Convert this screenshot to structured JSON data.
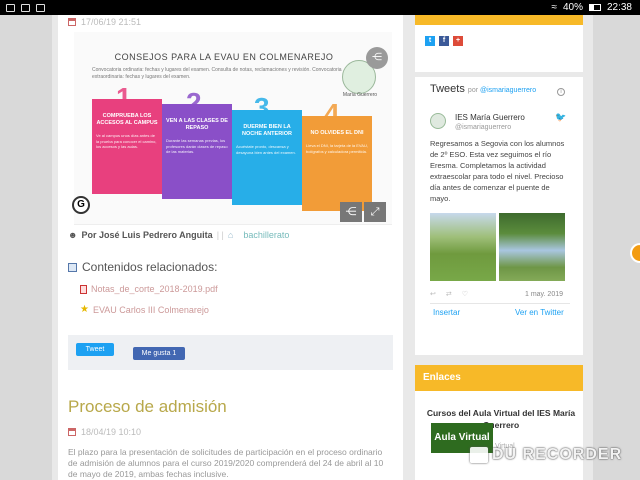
{
  "status_bar": {
    "time": "22:38",
    "battery": "40%"
  },
  "post1": {
    "date": "17/06/19 21:51",
    "infographic": {
      "title": "CONSEJOS PARA LA EVAU EN COLMENAREJO",
      "subtitle": "Convocatoria ordinaria: fechas y lugares del examen. Consulta de notas, reclamaciones y revisión. Convocatoria extraordinaria: fechas y lugares del examen.",
      "logo_label": "María Guerrero",
      "cards": [
        {
          "number": "1",
          "title": "COMPRUEBA LOS ACCESOS AL CAMPUS",
          "body": "Ve al campus unos días antes de la prueba para conocer el camino, los accesos y las aulas.",
          "color": "#e8407e"
        },
        {
          "number": "2",
          "title": "VEN A LAS CLASES DE REPASO",
          "body": "Durante las semanas previas, los profesores darán clases de repaso de las materias.",
          "color": "#8a4fc8"
        },
        {
          "number": "3",
          "title": "DUERME BIEN LA NOCHE ANTERIOR",
          "body": "Acuéstate pronto, descansa y desayuna bien antes del examen.",
          "color": "#27aee8"
        },
        {
          "number": "4",
          "title": "NO OLVIDES EL DNI",
          "body": "Lleva el DNI, la tarjeta de la EVAU, bolígrafos y calculadora permitida.",
          "color": "#f29c38"
        }
      ]
    },
    "author_label": "Por José Luis Pedrero Anguita",
    "tag": "bachillerato",
    "related_heading": "Contenidos relacionados:",
    "related": [
      {
        "label": "Notas_de_corte_2018-2019.pdf",
        "icon": "pdf-icon"
      },
      {
        "label": "EVAU Carlos III Colmenarejo",
        "icon": "star-icon"
      }
    ],
    "tweet_label": "Tweet",
    "like_label": "Me gusta 1"
  },
  "post2": {
    "title": "Proceso de admisión",
    "date": "18/04/19 10:10",
    "body": "El plazo para la presentación de solicitudes de participación en el proceso ordinario de admisión de alumnos para el curso 2019/2020 comprenderá del 24 de abril al 10 de mayo de 2019, ambas fechas inclusive."
  },
  "sidebar": {
    "tweets_widget": {
      "heading": "Tweets",
      "by_prefix": "por",
      "by_handle": "@ismariaguerrero",
      "account_name": "IES María Guerrero",
      "account_handle": "@ismariaguerrero",
      "text": "Regresamos a Segovia con los alumnos de 2º ESO. Esta vez seguimos el río Eresma. Completamos la actividad extraescolar para todo el nivel. Precioso día antes de comenzar el puente de mayo.",
      "date": "1 may. 2019",
      "embed_label": "Insertar",
      "view_label": "Ver en Twitter"
    },
    "links_widget": {
      "heading": "Enlaces",
      "link_title": "Cursos del Aula Virtual del IES María Guerrero",
      "logo_text": "Aula Virtual",
      "logo_sub": "Virtual"
    }
  },
  "watermark": "DU RECORDER",
  "colors": {
    "accent_orange": "#f7b928",
    "post_title": "#b8a84a",
    "twitter_blue": "#1da1f2"
  }
}
